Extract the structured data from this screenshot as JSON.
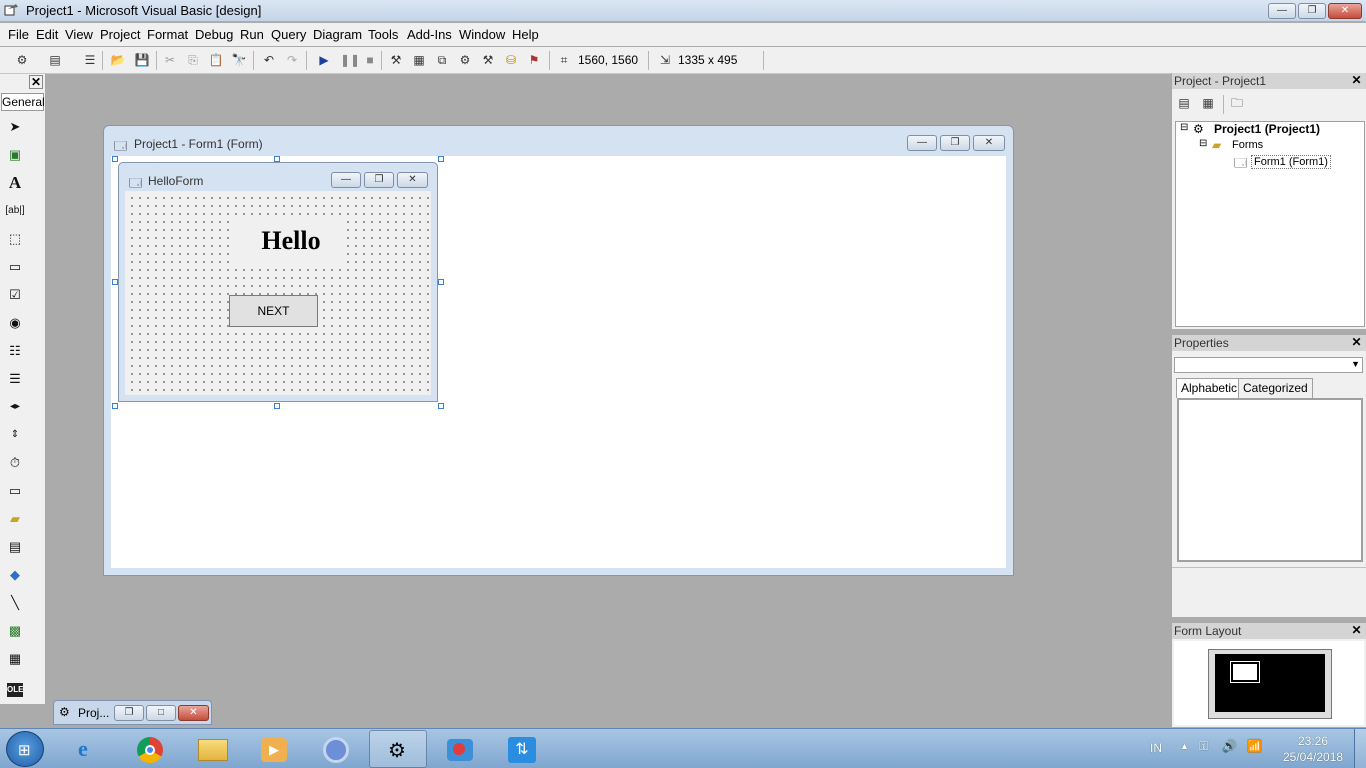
{
  "window": {
    "title": "Project1 - Microsoft Visual Basic [design]"
  },
  "menu": [
    "File",
    "Edit",
    "View",
    "Project",
    "Format",
    "Debug",
    "Run",
    "Query",
    "Diagram",
    "Tools",
    "Add-Ins",
    "Window",
    "Help"
  ],
  "toolbar": {
    "position": "1560, 1560",
    "size": "1335 x 495"
  },
  "toolbox": {
    "title": "General",
    "tools": [
      "pointer-icon",
      "picturebox-icon",
      "label-icon",
      "textbox-icon",
      "frame-icon",
      "commandbutton-icon",
      "checkbox-icon",
      "optionbutton-icon",
      "combobox-icon",
      "listbox-icon",
      "hscrollbar-icon",
      "vscrollbar-icon",
      "timer-icon",
      "drivelistbox-icon",
      "dirlistbox-icon",
      "filelistbox-icon",
      "shape-icon",
      "line-icon",
      "image-icon",
      "data-icon",
      "ole-icon"
    ]
  },
  "form_window": {
    "title": "Project1 - Form1 (Form)"
  },
  "hello_form": {
    "title": "HelloForm",
    "label": "Hello",
    "button": "NEXT"
  },
  "minimized": {
    "title": "Proj..."
  },
  "project_panel": {
    "title": "Project - Project1",
    "tree": {
      "project": "Project1 (Project1)",
      "folder": "Forms",
      "form": "Form1 (Form1)"
    }
  },
  "properties_panel": {
    "title": "Properties",
    "tabs": [
      "Alphabetic",
      "Categorized"
    ]
  },
  "form_layout_panel": {
    "title": "Form Layout"
  },
  "taskbar": {
    "lang": "IN",
    "time": "23:26",
    "date": "25/04/2018"
  }
}
